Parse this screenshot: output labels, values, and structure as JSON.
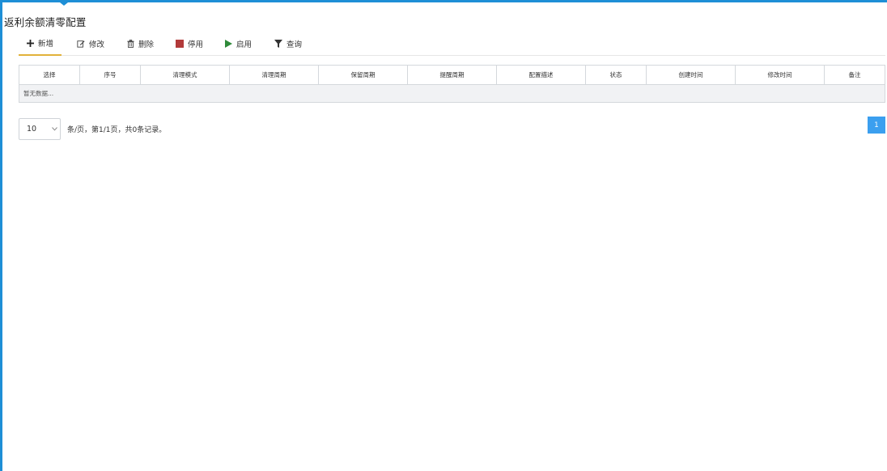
{
  "page": {
    "title": "返利余额清零配置"
  },
  "colors": {
    "accent": "#1e8fd6",
    "active_tab": "#e2b23a",
    "stop": "#b23a3a",
    "start": "#2f8a3a",
    "page_active": "#3b9fef"
  },
  "toolbar": [
    {
      "label": "新增",
      "icon": "plus-icon"
    },
    {
      "label": "修改",
      "icon": "edit-icon"
    },
    {
      "label": "删除",
      "icon": "trash-icon"
    },
    {
      "label": "停用",
      "icon": "stop-icon"
    },
    {
      "label": "启用",
      "icon": "play-icon"
    },
    {
      "label": "查询",
      "icon": "filter-icon"
    }
  ],
  "table": {
    "columns": [
      "选择",
      "序号",
      "清理模式",
      "清理周期",
      "保留周期",
      "提醒周期",
      "配置描述",
      "状态",
      "创建时间",
      "修改时间",
      "备注"
    ],
    "empty_text": "暂无数据..."
  },
  "pager": {
    "page_size": "10",
    "info": "条/页，第1/1页，共0条记录。",
    "pages": [
      "1"
    ]
  }
}
